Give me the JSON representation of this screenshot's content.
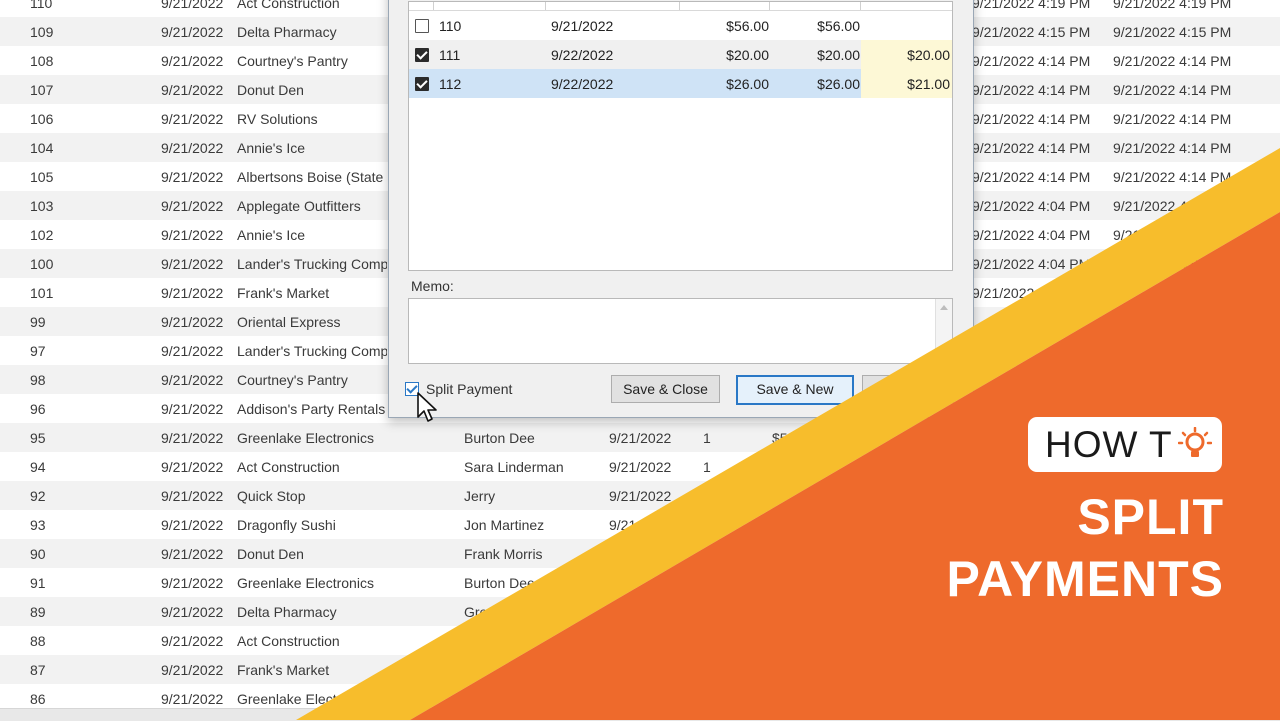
{
  "background_rows": [
    {
      "id": "110",
      "date": "9/21/2022",
      "customer": "Act Construction",
      "contact": "",
      "order_date": "",
      "qty": "",
      "amount": "",
      "ts1": "9/21/2022 4:19 PM",
      "ts2": "9/21/2022 4:19 PM"
    },
    {
      "id": "109",
      "date": "9/21/2022",
      "customer": "Delta Pharmacy",
      "contact": "",
      "order_date": "",
      "qty": "",
      "amount": "",
      "ts1": "9/21/2022 4:15 PM",
      "ts2": "9/21/2022 4:15 PM"
    },
    {
      "id": "108",
      "date": "9/21/2022",
      "customer": "Courtney's Pantry",
      "contact": "",
      "order_date": "",
      "qty": "",
      "amount": "",
      "ts1": "9/21/2022 4:14 PM",
      "ts2": "9/21/2022 4:14 PM"
    },
    {
      "id": "107",
      "date": "9/21/2022",
      "customer": "Donut Den",
      "contact": "",
      "order_date": "",
      "qty": "",
      "amount": "",
      "ts1": "9/21/2022 4:14 PM",
      "ts2": "9/21/2022 4:14 PM"
    },
    {
      "id": "106",
      "date": "9/21/2022",
      "customer": "RV Solutions",
      "contact": "",
      "order_date": "",
      "qty": "",
      "amount": "",
      "ts1": "9/21/2022 4:14 PM",
      "ts2": "9/21/2022 4:14 PM"
    },
    {
      "id": "104",
      "date": "9/21/2022",
      "customer": "Annie's Ice",
      "contact": "",
      "order_date": "",
      "qty": "",
      "amount": "",
      "ts1": "9/21/2022 4:14 PM",
      "ts2": "9/21/2022 4:14 PM"
    },
    {
      "id": "105",
      "date": "9/21/2022",
      "customer": "Albertsons Boise (State",
      "contact": "",
      "order_date": "",
      "qty": "",
      "amount": "",
      "ts1": "9/21/2022 4:14 PM",
      "ts2": "9/21/2022 4:14 PM"
    },
    {
      "id": "103",
      "date": "9/21/2022",
      "customer": "Applegate Outfitters",
      "contact": "",
      "order_date": "",
      "qty": "",
      "amount": "",
      "ts1": "9/21/2022 4:04 PM",
      "ts2": "9/21/2022 4:04 PM"
    },
    {
      "id": "102",
      "date": "9/21/2022",
      "customer": "Annie's Ice",
      "contact": "",
      "order_date": "",
      "qty": "",
      "amount": "",
      "ts1": "9/21/2022 4:04 PM",
      "ts2": "9/21/2022 4:04 PM"
    },
    {
      "id": "100",
      "date": "9/21/2022",
      "customer": "Lander's Trucking Comp",
      "contact": "",
      "order_date": "",
      "qty": "",
      "amount": "",
      "ts1": "9/21/2022 4:04 PM",
      "ts2": "9/21/2022 4:04 PM"
    },
    {
      "id": "101",
      "date": "9/21/2022",
      "customer": "Frank's Market",
      "contact": "",
      "order_date": "",
      "qty": "",
      "amount": "",
      "ts1": "9/21/2022 4:04 PM",
      "ts2": ""
    },
    {
      "id": "99",
      "date": "9/21/2022",
      "customer": "Oriental Express",
      "contact": "",
      "order_date": "",
      "qty": "",
      "amount": "",
      "ts1": "",
      "ts2": ""
    },
    {
      "id": "97",
      "date": "9/21/2022",
      "customer": "Lander's Trucking Comp",
      "contact": "",
      "order_date": "",
      "qty": "",
      "amount": "",
      "ts1": "",
      "ts2": ""
    },
    {
      "id": "98",
      "date": "9/21/2022",
      "customer": "Courtney's Pantry",
      "contact": "",
      "order_date": "",
      "qty": "",
      "amount": "",
      "ts1": "",
      "ts2": ""
    },
    {
      "id": "96",
      "date": "9/21/2022",
      "customer": "Addison's Party Rentals",
      "contact": "",
      "order_date": "",
      "qty": "",
      "amount": "",
      "ts1": "",
      "ts2": ""
    },
    {
      "id": "95",
      "date": "9/21/2022",
      "customer": "Greenlake Electronics",
      "contact": "Burton Dee",
      "order_date": "9/21/2022",
      "qty": "1",
      "amount": "$5",
      "ts1": "",
      "ts2": ""
    },
    {
      "id": "94",
      "date": "9/21/2022",
      "customer": "Act Construction",
      "contact": "Sara Linderman",
      "order_date": "9/21/2022",
      "qty": "1",
      "amount": "",
      "ts1": "",
      "ts2": ""
    },
    {
      "id": "92",
      "date": "9/21/2022",
      "customer": "Quick Stop",
      "contact": "Jerry",
      "order_date": "9/21/2022",
      "qty": "",
      "amount": "",
      "ts1": "",
      "ts2": ""
    },
    {
      "id": "93",
      "date": "9/21/2022",
      "customer": "Dragonfly Sushi",
      "contact": "Jon Martinez",
      "order_date": "9/21",
      "qty": "",
      "amount": "",
      "ts1": "",
      "ts2": ""
    },
    {
      "id": "90",
      "date": "9/21/2022",
      "customer": "Donut Den",
      "contact": "Frank Morris",
      "order_date": "",
      "qty": "",
      "amount": "",
      "ts1": "",
      "ts2": ""
    },
    {
      "id": "91",
      "date": "9/21/2022",
      "customer": "Greenlake Electronics",
      "contact": "Burton Dee",
      "order_date": "",
      "qty": "",
      "amount": "",
      "ts1": "",
      "ts2": ""
    },
    {
      "id": "89",
      "date": "9/21/2022",
      "customer": "Delta Pharmacy",
      "contact": "Gre",
      "order_date": "",
      "qty": "",
      "amount": "",
      "ts1": "",
      "ts2": ""
    },
    {
      "id": "88",
      "date": "9/21/2022",
      "customer": "Act Construction",
      "contact": "",
      "order_date": "",
      "qty": "",
      "amount": "",
      "ts1": "",
      "ts2": ""
    },
    {
      "id": "87",
      "date": "9/21/2022",
      "customer": "Frank's Market",
      "contact": "",
      "order_date": "",
      "qty": "",
      "amount": "",
      "ts1": "",
      "ts2": ""
    },
    {
      "id": "86",
      "date": "9/21/2022",
      "customer": "Greenlake Electr",
      "contact": "",
      "order_date": "",
      "qty": "",
      "amount": "",
      "ts1": "",
      "ts2": ""
    }
  ],
  "dialog": {
    "invoices": [
      {
        "checked": false,
        "id": "110",
        "date": "9/21/2022",
        "amount": "$56.00",
        "balance": "$56.00",
        "applied": "",
        "selected": false
      },
      {
        "checked": true,
        "id": "111",
        "date": "9/22/2022",
        "amount": "$20.00",
        "balance": "$20.00",
        "applied": "$20.00",
        "selected": false
      },
      {
        "checked": true,
        "id": "112",
        "date": "9/22/2022",
        "amount": "$26.00",
        "balance": "$26.00",
        "applied": "$21.00",
        "selected": true
      }
    ],
    "memo_label": "Memo:",
    "memo_value": "",
    "split_payment_label": "Split Payment",
    "split_payment_checked": true,
    "save_close_label": "Save & Close",
    "save_new_label": "Save & New"
  },
  "banner": {
    "how_to": "HOW T",
    "title_line1": "SPLIT",
    "title_line2": "PAYMENTS",
    "colors": {
      "orange": "#ee6a2c",
      "yellow": "#f7bd2c",
      "white": "#ffffff"
    }
  }
}
